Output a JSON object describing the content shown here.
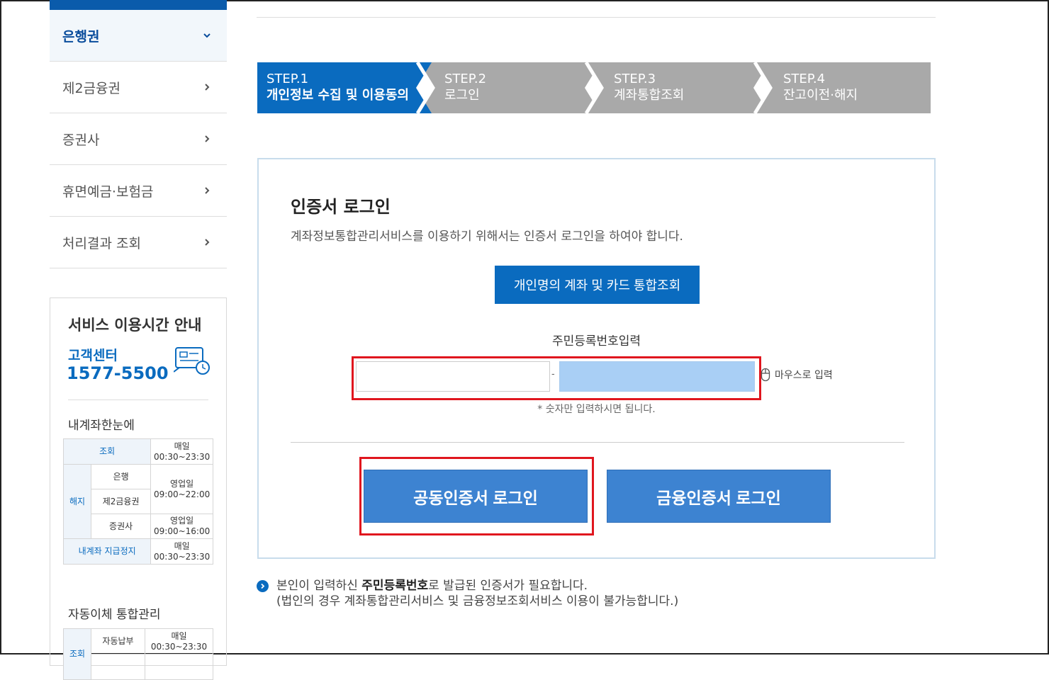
{
  "sidebar": {
    "items": [
      {
        "label": "은행권",
        "active": true
      },
      {
        "label": "제2금융권"
      },
      {
        "label": "증권사"
      },
      {
        "label": "휴면예금·보험금"
      },
      {
        "label": "처리결과 조회"
      }
    ],
    "service_hours": {
      "title": "서비스 이용시간 안내",
      "cs_label": "고객센터",
      "cs_phone": "1577-5500",
      "section1_title": "내계좌한눈에",
      "table1": {
        "inquiry": "조회",
        "daily": "매일",
        "time_all": "00:30~23:30",
        "cancel": "해지",
        "bank": "은행",
        "second": "제2금융권",
        "securities": "증권사",
        "bizday": "영업일",
        "time_bank": "09:00~22:00",
        "time_sec": "09:00~16:00",
        "suspend": "내계좌 지급정지"
      },
      "section2_title": "자동이체 통합관리",
      "table2": {
        "inquiry": "조회",
        "autopay": "자동납부",
        "daily": "매일",
        "time": "00:30~23:30"
      }
    }
  },
  "steps": [
    {
      "step": "STEP.1",
      "name": "개인정보 수집 및 이용동의",
      "active": true
    },
    {
      "step": "STEP.2",
      "name": "로그인"
    },
    {
      "step": "STEP.3",
      "name": "계좌통합조회"
    },
    {
      "step": "STEP.4",
      "name": "잔고이전·해지"
    }
  ],
  "login": {
    "title": "인증서 로그인",
    "description": "계좌정보통합관리서비스를 이용하기 위해서는 인증서 로그인을 하여야 합니다.",
    "personal_button": "개인명의 계좌 및 카드 통합조회",
    "rrn_label": "주민등록번호입력",
    "rrn_dash": "-",
    "mouse_input": "마우스로 입력",
    "rrn_note": "* 숫자만 입력하시면 됩니다.",
    "joint_cert_button": "공동인증서 로그인",
    "fin_cert_button": "금융인증서 로그인"
  },
  "notice": {
    "line1_pre": "본인이 입력하신 ",
    "line1_bold": "주민등록번호",
    "line1_post": "로 발급된 인증서가 필요합니다.",
    "line2": "(법인의 경우 계좌통합관리서비스 및 금융정보조회서비스 이용이 불가능합니다.)"
  },
  "colors": {
    "primary": "#0a6bbf",
    "step_inactive": "#a9a9a9",
    "highlight": "#e0161e",
    "cert_button": "#3d83d1"
  }
}
